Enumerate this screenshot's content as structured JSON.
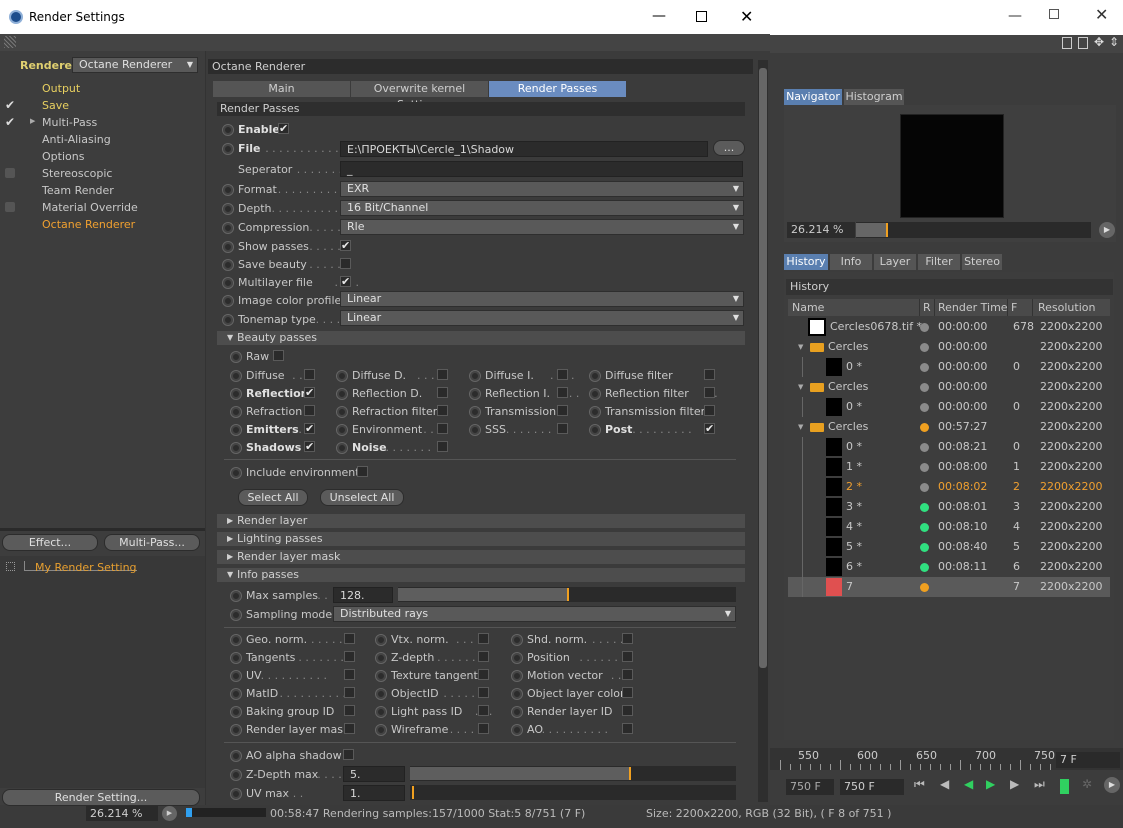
{
  "window": {
    "title": "Render Settings"
  },
  "left": {
    "renderer_label": "Renderer",
    "renderer_value": "Octane Renderer",
    "items": [
      {
        "label": "Output",
        "checked": false,
        "highlight": true
      },
      {
        "label": "Save",
        "checked": true,
        "highlight": true
      },
      {
        "label": "Multi-Pass",
        "checked": true,
        "highlight": false
      },
      {
        "label": "Anti-Aliasing",
        "checked": false,
        "highlight": false
      },
      {
        "label": "Options",
        "checked": false,
        "highlight": false
      },
      {
        "label": "Stereoscopic",
        "checked": false,
        "highlight": false
      },
      {
        "label": "Team Render",
        "checked": false,
        "highlight": false
      },
      {
        "label": "Material Override",
        "checked": false,
        "highlight": false
      },
      {
        "label": "Octane Renderer",
        "checked": false,
        "highlight": false
      }
    ],
    "effect_btn": "Effect...",
    "multipass_btn": "Multi-Pass...",
    "my_setting": "My Render Setting",
    "render_setting_btn": "Render Setting..."
  },
  "panel": {
    "title": "Octane Renderer",
    "tabs": [
      "Main",
      "Overwrite kernel Settings",
      "Render Passes"
    ],
    "section": "Render Passes",
    "enable": "Enable",
    "file_label": "File",
    "file_value": "E:\\ПРОЕКТЫ\\Cercle_1\\Shadow",
    "file_btn": "...",
    "separator_label": "Seperator",
    "separator_value": "_",
    "format_label": "Format",
    "format_value": "EXR",
    "depth_label": "Depth",
    "depth_value": "16 Bit/Channel",
    "compression_label": "Compression",
    "compression_value": "Rle",
    "show_passes": "Show passes",
    "save_beauty": "Save beauty",
    "multilayer": "Multilayer file",
    "image_profile_label": "Image color profile",
    "image_profile_value": "Linear",
    "tonemap_label": "Tonemap type",
    "tonemap_value": "Linear",
    "beauty_section": "Beauty passes",
    "raw": "Raw",
    "beauty": [
      [
        "Diffuse",
        "Diffuse D.",
        "Diffuse I.",
        "Diffuse filter"
      ],
      [
        "Reflection",
        "Reflection D.",
        "Reflection I.",
        "Reflection filter"
      ],
      [
        "Refraction",
        "Refraction filter",
        "Transmission",
        "Transmission filter"
      ],
      [
        "Emitters",
        "Environment",
        "SSS",
        "Post"
      ],
      [
        "Shadows",
        "Noise"
      ]
    ],
    "include_env": "Include environment",
    "select_all": "Select All",
    "unselect_all": "Unselect All",
    "render_layer": "Render layer",
    "lighting_passes": "Lighting passes",
    "render_layer_mask": "Render layer mask",
    "info_section": "Info passes",
    "max_samples_label": "Max samples",
    "max_samples_value": "128.",
    "sampling_label": "Sampling mode",
    "sampling_value": "Distributed rays",
    "info": [
      [
        "Geo. norm.",
        "Vtx. norm.",
        "Shd. norm."
      ],
      [
        "Tangents",
        "Z-depth",
        "Position"
      ],
      [
        "UV",
        "Texture tangent",
        "Motion vector"
      ],
      [
        "MatID",
        "ObjectID",
        "Object layer color"
      ],
      [
        "Baking group ID",
        "Light pass ID",
        "Render layer ID"
      ],
      [
        "Render layer mask",
        "Wireframe",
        "AO"
      ]
    ],
    "ao_alpha": "AO alpha shadow",
    "zdepth_label": "Z-Depth max",
    "zdepth_value": "5.",
    "uvmax_label": "UV max",
    "uvmax_value": "1."
  },
  "navigator": {
    "tabs": [
      "Navigator",
      "Histogram"
    ],
    "zoom": "26.214 %"
  },
  "history": {
    "tabs": [
      "History",
      "Info",
      "Layer",
      "Filter",
      "Stereo"
    ],
    "title": "History",
    "cols": [
      "Name",
      "R",
      "Render Time",
      "F",
      "Resolution"
    ],
    "rows": [
      {
        "name": "Cercles0678.tif *",
        "time": "00:00:00",
        "f": "678",
        "res": "2200x2200",
        "dot": "#8a8a8a",
        "kind": "file"
      },
      {
        "name": "Cercles",
        "time": "00:00:00",
        "f": "",
        "res": "2200x2200",
        "dot": "#8a8a8a",
        "kind": "folder"
      },
      {
        "name": "0 *",
        "time": "00:00:00",
        "f": "0",
        "res": "2200x2200",
        "dot": "#8a8a8a",
        "kind": "item"
      },
      {
        "name": "Cercles",
        "time": "00:00:00",
        "f": "",
        "res": "2200x2200",
        "dot": "#8a8a8a",
        "kind": "folder"
      },
      {
        "name": "0 *",
        "time": "00:00:00",
        "f": "0",
        "res": "2200x2200",
        "dot": "#8a8a8a",
        "kind": "item"
      },
      {
        "name": "Cercles",
        "time": "00:57:27",
        "f": "",
        "res": "2200x2200",
        "dot": "#f0a020",
        "kind": "folder"
      },
      {
        "name": "0 *",
        "time": "00:08:21",
        "f": "0",
        "res": "2200x2200",
        "dot": "#8a8a8a",
        "kind": "item"
      },
      {
        "name": "1 *",
        "time": "00:08:00",
        "f": "1",
        "res": "2200x2200",
        "dot": "#8a8a8a",
        "kind": "item"
      },
      {
        "name": "2 *",
        "time": "00:08:02",
        "f": "2",
        "res": "2200x2200",
        "dot": "#8a8a8a",
        "kind": "item"
      },
      {
        "name": "3 *",
        "time": "00:08:01",
        "f": "3",
        "res": "2200x2200",
        "dot": "#30e080",
        "kind": "item"
      },
      {
        "name": "4 *",
        "time": "00:08:10",
        "f": "4",
        "res": "2200x2200",
        "dot": "#30e080",
        "kind": "item"
      },
      {
        "name": "5 *",
        "time": "00:08:40",
        "f": "5",
        "res": "2200x2200",
        "dot": "#30e080",
        "kind": "item"
      },
      {
        "name": "6 *",
        "time": "00:08:11",
        "f": "6",
        "res": "2200x2200",
        "dot": "#30e080",
        "kind": "item"
      },
      {
        "name": "7",
        "time": "",
        "f": "7",
        "res": "2200x2200",
        "dot": "#f0a020",
        "kind": "current"
      }
    ]
  },
  "timeline": {
    "ticks": [
      "550",
      "600",
      "650",
      "700",
      "750"
    ],
    "frame1": "7 F",
    "frame2": "750 F",
    "frame3": "750 F"
  },
  "status": {
    "zoom": "26.214 %",
    "text": "00:58:47 Rendering samples:157/1000 Stat:5 8/751 (7 F)",
    "info": "Size: 2200x2200, RGB (32 Bit),  ( F 8 of 751 )"
  }
}
